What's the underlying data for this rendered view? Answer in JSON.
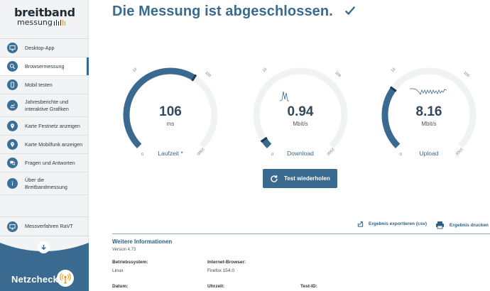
{
  "logo": {
    "top": "breitband",
    "bottom": "messung"
  },
  "sidebar": {
    "items": [
      {
        "label": "Desktop-App"
      },
      {
        "label": "Browsermessung"
      },
      {
        "label": "Mobil testen"
      },
      {
        "label": "Jahresberichte und interaktive Grafiken"
      },
      {
        "label": "Karte Festnetz anzeigen"
      },
      {
        "label": "Karte Mobilfunk anzeigen"
      },
      {
        "label": "Fragen und Antworten"
      },
      {
        "label": "Über die Breitbandmessung"
      }
    ],
    "bottom_item": {
      "label": "Messverfahren RaVT"
    },
    "netzcheck": "Netzcheck"
  },
  "main": {
    "title": "Die Messung ist abgeschlossen.",
    "gauges": [
      {
        "value": "106",
        "unit": "ms",
        "label": "Laufzeit *",
        "ticks": [
          "0",
          "10",
          "100",
          "1000"
        ],
        "fill_fraction": 0.62
      },
      {
        "value": "0.94",
        "unit": "Mbit/s",
        "label": "Download",
        "ticks": [
          "0",
          "10",
          "100",
          "1000"
        ],
        "fill_fraction": 0.04
      },
      {
        "value": "8.16",
        "unit": "Mbit/s",
        "label": "Upload",
        "ticks": [
          "0",
          "10",
          "100",
          "1000"
        ],
        "fill_fraction": 0.3
      }
    ],
    "retry_label": "Test wiederholen",
    "export_label": "Ergebnis exportieren (csv)",
    "print_label": "Ergebnis drucken",
    "info": {
      "title": "Weitere Informationen",
      "version": "Version 4.73",
      "os_label": "Betriebssystem:",
      "os_value": "Linux",
      "browser_label": "Internet-Browser:",
      "browser_value": "Firefox 154.0",
      "date_label": "Datum:",
      "time_label": "Uhrzeit:",
      "testid_label": "Test-ID:"
    }
  },
  "colors": {
    "accent": "#3a6a8f",
    "gauge_track": "#f1f2f3",
    "logo_orange": "#f29400"
  }
}
